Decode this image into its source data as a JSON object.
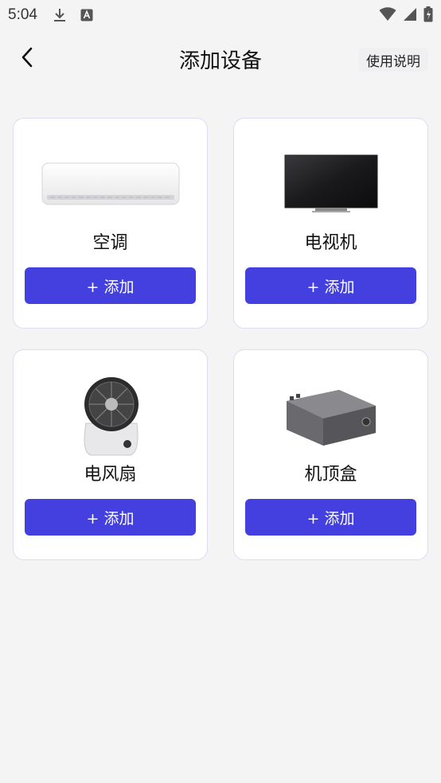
{
  "status_bar": {
    "time": "5:04",
    "icons": [
      "download-icon",
      "font-icon",
      "wifi-icon",
      "signal-icon",
      "battery-icon"
    ]
  },
  "header": {
    "title": "添加设备",
    "help_label": "使用说明",
    "back_icon": "chevron-left-icon"
  },
  "colors": {
    "accent": "#4440e0",
    "background": "#f4f4f5",
    "card_border": "#dcdcf2"
  },
  "devices": [
    {
      "name": "空调",
      "button": "+ 添加",
      "icon": "air-conditioner-image"
    },
    {
      "name": "电视机",
      "button": "+ 添加",
      "icon": "television-image"
    },
    {
      "name": "电风扇",
      "button": "+ 添加",
      "icon": "electric-fan-image"
    },
    {
      "name": "机顶盒",
      "button": "+ 添加",
      "icon": "set-top-box-image"
    }
  ]
}
